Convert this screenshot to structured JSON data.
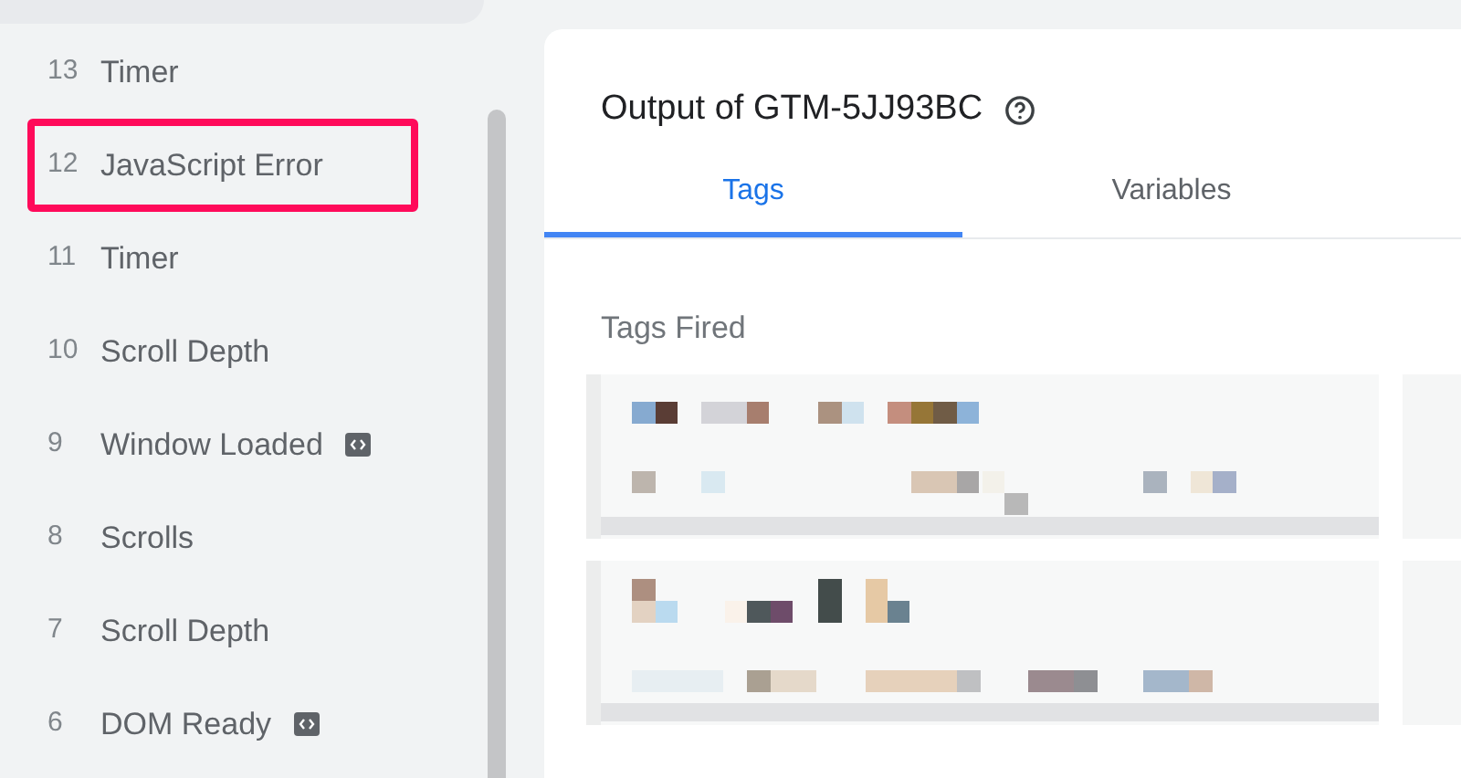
{
  "events": [
    {
      "number": "13",
      "name": "Timer",
      "highlighted": false,
      "code_badge": false
    },
    {
      "number": "12",
      "name": "JavaScript Error",
      "highlighted": true,
      "code_badge": false
    },
    {
      "number": "11",
      "name": "Timer",
      "highlighted": false,
      "code_badge": false
    },
    {
      "number": "10",
      "name": "Scroll Depth",
      "highlighted": false,
      "code_badge": false
    },
    {
      "number": "9",
      "name": "Window Loaded",
      "highlighted": false,
      "code_badge": true
    },
    {
      "number": "8",
      "name": "Scrolls",
      "highlighted": false,
      "code_badge": false
    },
    {
      "number": "7",
      "name": "Scroll Depth",
      "highlighted": false,
      "code_badge": false
    },
    {
      "number": "6",
      "name": "DOM Ready",
      "highlighted": false,
      "code_badge": true
    }
  ],
  "output": {
    "title": "Output of GTM-5JJ93BC",
    "tabs": [
      {
        "label": "Tags",
        "selected": true
      },
      {
        "label": "Variables",
        "selected": false
      }
    ],
    "section": "Tags Fired"
  }
}
